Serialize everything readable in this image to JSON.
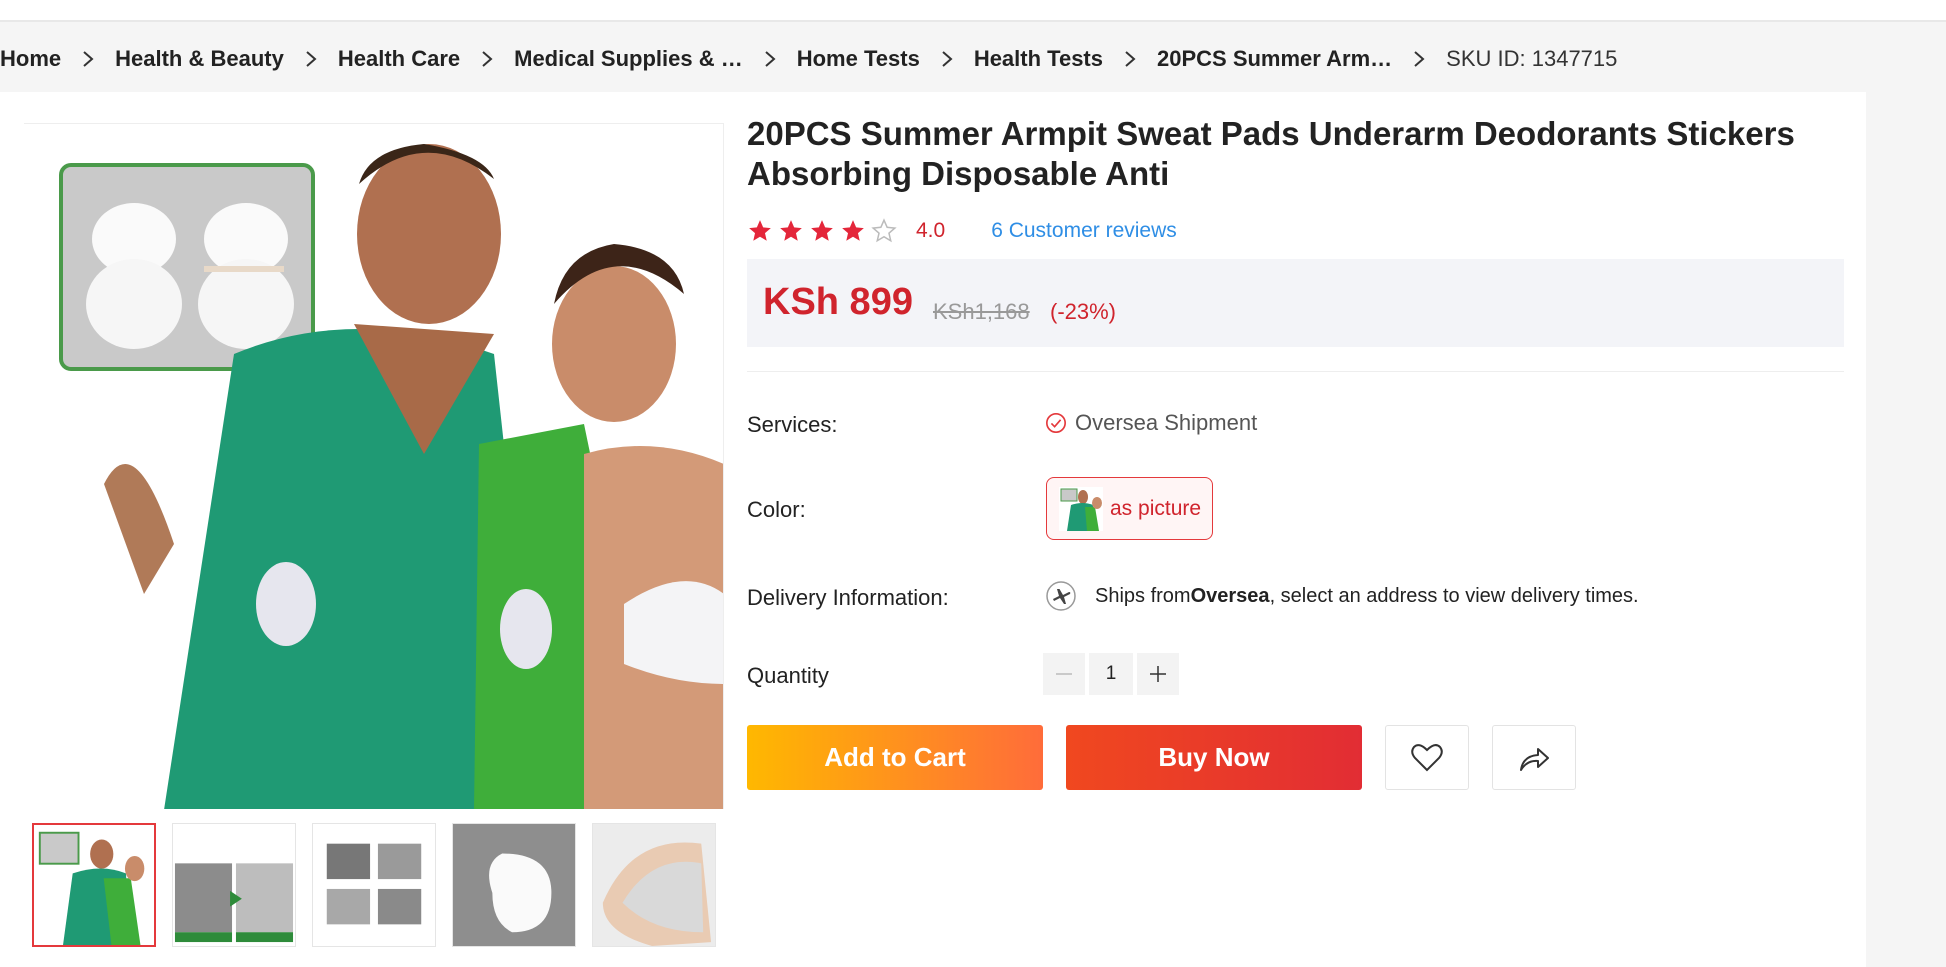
{
  "breadcrumb": {
    "items": [
      "Home",
      "Health & Beauty",
      "Health Care",
      "Medical Supplies & …",
      "Home Tests",
      "Health Tests",
      "20PCS Summer Arm…"
    ],
    "sku": "SKU ID: 1347715"
  },
  "product": {
    "title": "20PCS Summer Armpit Sweat Pads Underarm Deodorants Stickers Absorbing Disposable Anti",
    "rating_value": "4.0",
    "rating_stars": 4,
    "reviews_link": "6 Customer reviews",
    "price": "KSh 899",
    "old_price": "KSh1,168",
    "discount": "(-23%)"
  },
  "details": {
    "services_label": "Services:",
    "service_value": "Oversea Shipment",
    "color_label": "Color:",
    "color_value": "as picture",
    "delivery_label": "Delivery Information:",
    "delivery_prefix": "Ships from ",
    "delivery_origin": "Oversea",
    "delivery_suffix": ", select an address to view delivery times.",
    "quantity_label": "Quantity",
    "quantity_value": "1"
  },
  "actions": {
    "add_to_cart": "Add to Cart",
    "buy_now": "Buy Now"
  },
  "icons": {
    "breadcrumb_separator": "chevron-right-icon",
    "rating": "star-icon",
    "service": "check-circle-icon",
    "delivery": "airplane-icon",
    "decrease": "minus-icon",
    "increase": "plus-icon",
    "wishlist": "heart-icon",
    "share": "share-icon"
  },
  "colors": {
    "accent_red": "#d0242d",
    "link_blue": "#2f8ee5",
    "cart_gradient_start": "#ffb800",
    "cart_gradient_end": "#ff6c3a",
    "buy_gradient_start": "#f0481f",
    "buy_gradient_end": "#e22d34"
  },
  "gallery": {
    "thumbnail_count": 5,
    "active_thumbnail": 1
  }
}
